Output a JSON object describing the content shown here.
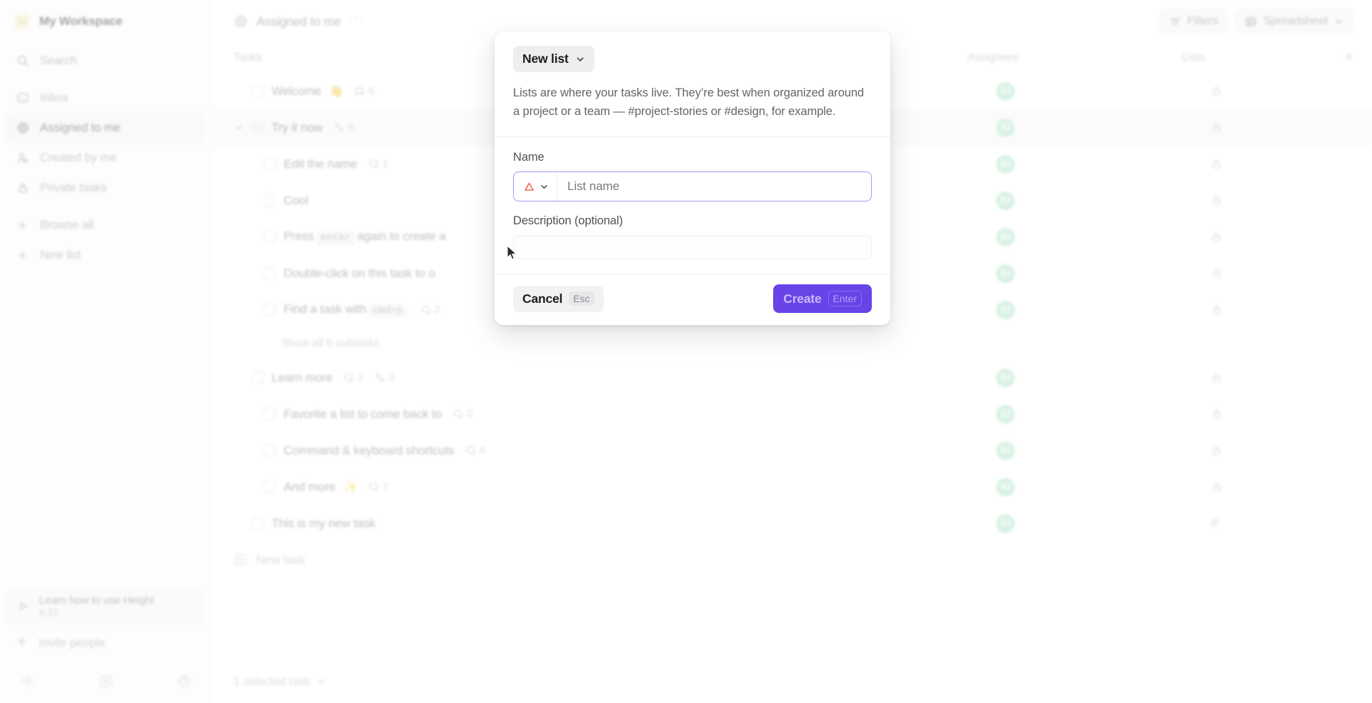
{
  "sidebar": {
    "workspace": {
      "initial": "M",
      "name": "My Workspace"
    },
    "nav": [
      {
        "label": "Search",
        "icon": "search-icon",
        "id": "search",
        "active": false
      },
      {
        "label": "Inbox",
        "icon": "inbox-icon",
        "id": "inbox",
        "active": false
      },
      {
        "label": "Assigned to me",
        "icon": "target-icon",
        "id": "assigned-to-me",
        "active": true
      },
      {
        "label": "Created by me",
        "icon": "user-icon",
        "id": "created-by-me",
        "active": false
      },
      {
        "label": "Private tasks",
        "icon": "lock-icon",
        "id": "private-tasks",
        "active": false
      },
      {
        "label": "Browse all",
        "icon": "plus-icon",
        "id": "browse-all",
        "active": false
      },
      {
        "label": "New list",
        "icon": "plus-icon",
        "id": "new-list",
        "active": false
      }
    ],
    "learn_card": {
      "title": "Learn how to use Height",
      "duration": "6:23",
      "icon": "play-icon"
    },
    "invite": {
      "label": "Invite people",
      "icon": "plus-icon"
    },
    "footer_icons": [
      "gear-icon",
      "new-window-icon",
      "help-icon"
    ]
  },
  "topbar": {
    "view_icon": "target-icon",
    "view_title": "Assigned to me",
    "more_label": "···",
    "filters_label": "Filters",
    "spreadsheet_label": "Spreadsheet"
  },
  "columns": {
    "tasks": "Tasks",
    "assignees": "Assignees",
    "lists": "Lists",
    "add_label": "+"
  },
  "tasks": [
    {
      "name": "Welcome",
      "emoji": "👋",
      "indent": 0,
      "chevron": false,
      "comments": "5",
      "subtasks": null,
      "selected": false,
      "checkbox": "empty",
      "assignee": "SJ",
      "list_icon": "lock-icon"
    },
    {
      "name": "Try it now",
      "emoji": "",
      "indent": 0,
      "chevron": true,
      "comments": null,
      "subtasks": "6",
      "selected": true,
      "checkbox": "filled",
      "assignee": "SJ",
      "list_icon": "lock-icon"
    },
    {
      "name": "Edit the name",
      "emoji": "",
      "indent": 1,
      "chevron": false,
      "comments": "1",
      "subtasks": null,
      "selected": false,
      "checkbox": "empty",
      "assignee": "SJ",
      "list_icon": "lock-icon"
    },
    {
      "name": "Cool",
      "emoji": "",
      "indent": 1,
      "chevron": false,
      "comments": null,
      "subtasks": null,
      "selected": false,
      "checkbox": "empty",
      "assignee": "SJ",
      "list_icon": "lock-icon"
    },
    {
      "name_pre": "Press",
      "kbd": "enter",
      "name_post": "again to create a",
      "indent": 1,
      "chevron": false,
      "comments": null,
      "subtasks": null,
      "selected": false,
      "checkbox": "empty",
      "assignee": "SJ",
      "list_icon": "lock-icon"
    },
    {
      "name": "Double-click on this task to o",
      "emoji": "",
      "indent": 1,
      "chevron": false,
      "comments": null,
      "subtasks": null,
      "selected": false,
      "checkbox": "empty",
      "assignee": "SJ",
      "list_icon": "lock-icon"
    },
    {
      "name_pre": "Find a task with",
      "kbd": "cmd+p",
      "name_post": "",
      "comments": "2",
      "indent": 1,
      "chevron": false,
      "subtasks": null,
      "selected": false,
      "checkbox": "empty",
      "assignee": "SJ",
      "list_icon": "lock-icon"
    },
    {
      "name": "Learn more",
      "emoji": "",
      "indent": 0,
      "chevron": false,
      "comments": "2",
      "subtasks": "3",
      "selected": false,
      "checkbox": "empty",
      "assignee": "SJ",
      "list_icon": "lock-icon"
    },
    {
      "name": "Favorite a list to come back to",
      "emoji": "",
      "indent": 1,
      "chevron": false,
      "comments": "2",
      "subtasks": null,
      "selected": false,
      "checkbox": "empty",
      "assignee": "SJ",
      "list_icon": "lock-icon"
    },
    {
      "name": "Command & keyboard shortcuts",
      "emoji": "",
      "indent": 1,
      "chevron": false,
      "comments": "4",
      "subtasks": null,
      "selected": false,
      "checkbox": "empty",
      "assignee": "SJ",
      "list_icon": "lock-icon"
    },
    {
      "name": "And more",
      "emoji": "✨",
      "indent": 1,
      "chevron": false,
      "comments": "7",
      "subtasks": null,
      "selected": false,
      "checkbox": "empty",
      "assignee": "SJ",
      "list_icon": "lock-icon"
    },
    {
      "name": "This is my new task",
      "emoji": "",
      "indent": 0,
      "chevron": false,
      "comments": null,
      "subtasks": null,
      "selected": false,
      "checkbox": "empty",
      "assignee": "SJ",
      "list_icon": "hash-icon"
    }
  ],
  "show_subtasks_label": "Show all 6 subtasks",
  "new_task_label": "New task",
  "statusbar": {
    "label": "1 selected task"
  },
  "modal": {
    "type_label": "New list",
    "description": "Lists are where your tasks live. They’re best when organized around a project or a team — #project-stories or #design, for example.",
    "name_label": "Name",
    "name_value": "",
    "name_placeholder": "List name",
    "icon_glyph": "triangle-icon",
    "desc_label": "Description (optional)",
    "desc_value": "",
    "desc_placeholder": "",
    "cancel_label": "Cancel",
    "cancel_kbd": "Esc",
    "create_label": "Create",
    "create_kbd": "Enter"
  },
  "colors": {
    "accent": "#6843e8",
    "focus_border": "#a39bf0",
    "icon_orange": "#ef6a4a",
    "avatar_green": "#a9e2c0",
    "workspace_logo": "#f3efca"
  }
}
